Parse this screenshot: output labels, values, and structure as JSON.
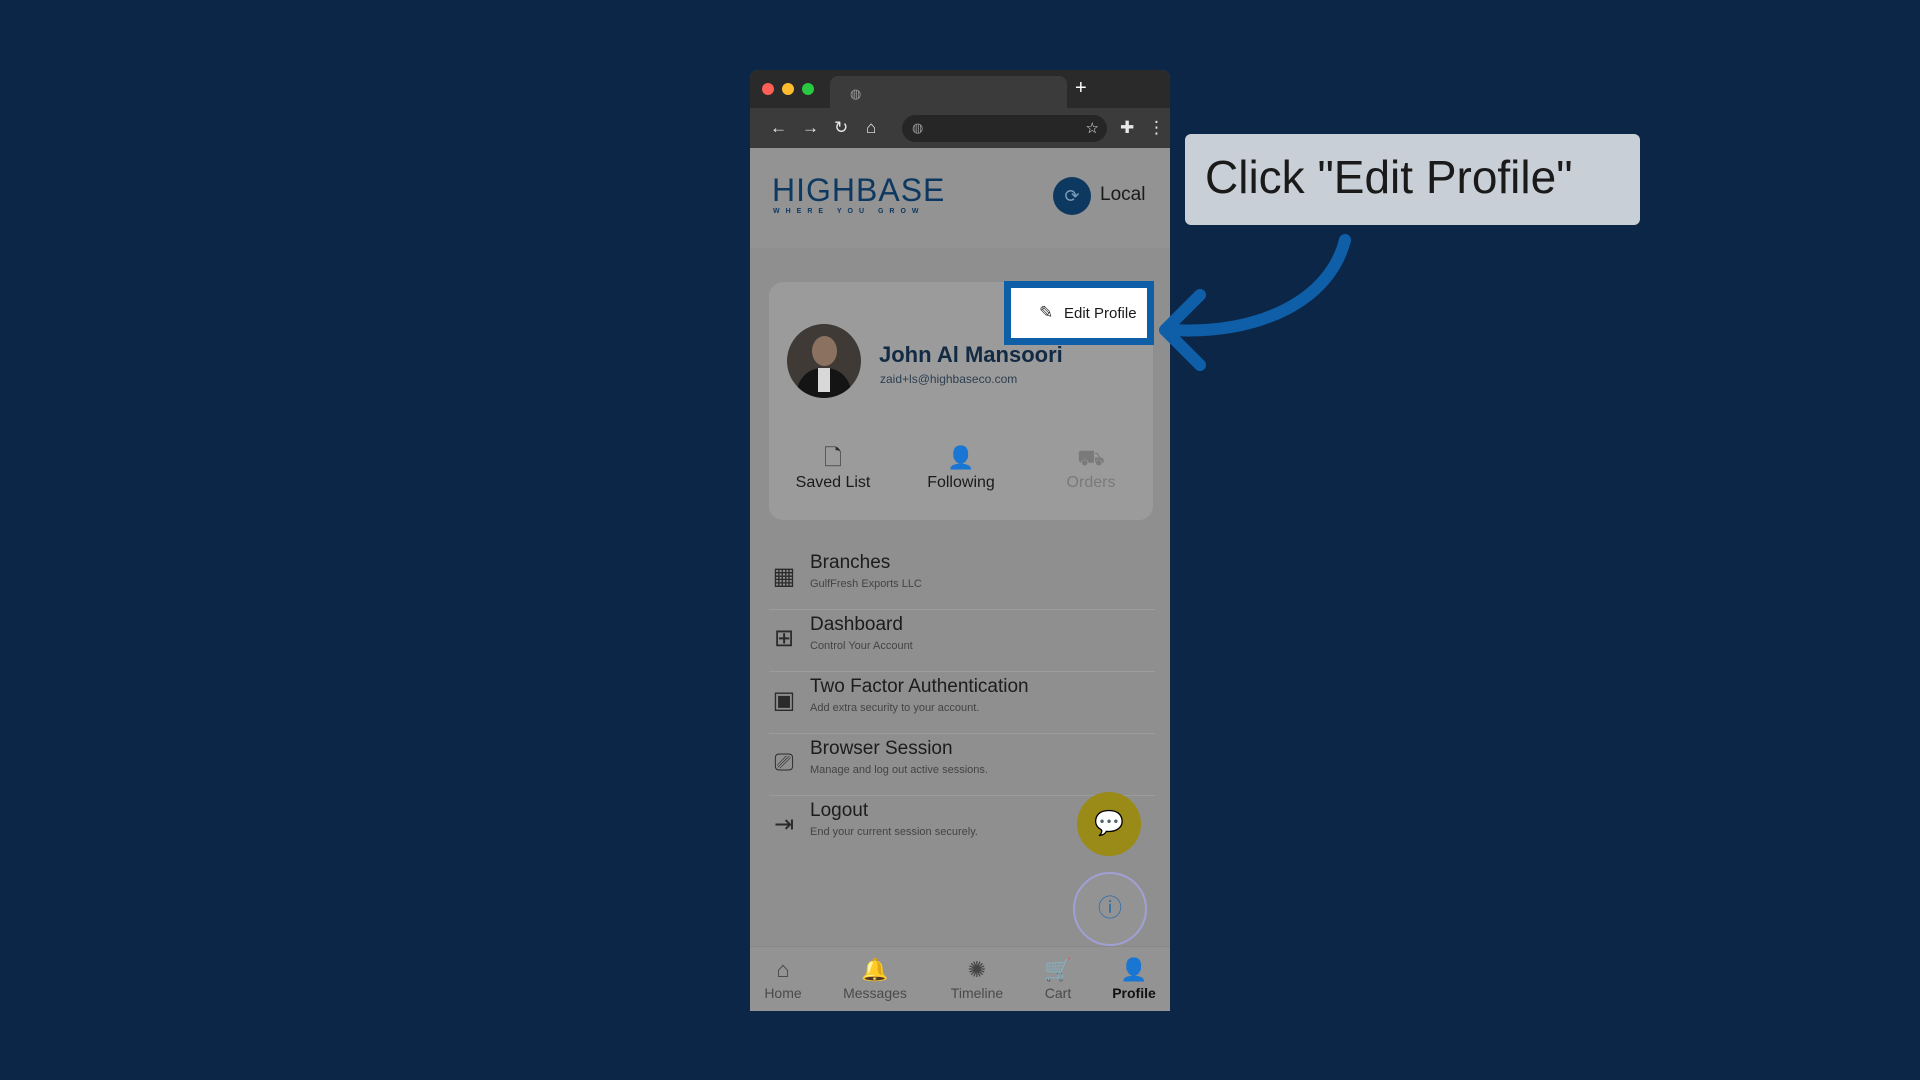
{
  "browser": {
    "controls": [
      "close",
      "minimize",
      "maximize"
    ],
    "tab_icon": "globe-icon",
    "new_tab_label": "+",
    "nav_icons": [
      "back-arrow-icon",
      "forward-arrow-icon",
      "reload-icon",
      "home-icon"
    ],
    "address_icon": "globe-icon",
    "right_icons": [
      "bookmark-star-icon",
      "extensions-icon",
      "menu-dots-icon"
    ]
  },
  "header": {
    "logo_text": "HIGHBASE",
    "logo_tagline": "WHERE YOU GROW",
    "language_label": "Local"
  },
  "profile": {
    "edit_button_label": "Edit Profile",
    "name": "John Al Mansoori",
    "email": "zaid+ls@highbaseco.com",
    "quick_actions": [
      {
        "label": "Saved List",
        "icon": "document-icon"
      },
      {
        "label": "Following",
        "icon": "user-plus-icon"
      },
      {
        "label": "Orders",
        "icon": "truck-icon"
      }
    ]
  },
  "menu": [
    {
      "title": "Branches",
      "subtitle": "GulfFresh Exports LLC",
      "icon": "building-icon"
    },
    {
      "title": "Dashboard",
      "subtitle": "Control Your Account",
      "icon": "grid-icon"
    },
    {
      "title": "Two Factor Authentication",
      "subtitle": "Add extra security to your account.",
      "icon": "shield-screen-icon"
    },
    {
      "title": "Browser Session",
      "subtitle": "Manage and log out active sessions.",
      "icon": "monitor-user-icon"
    },
    {
      "title": "Logout",
      "subtitle": "End your current session securely.",
      "icon": "logout-icon"
    }
  ],
  "bottom_nav": [
    {
      "label": "Home",
      "icon": "home-icon"
    },
    {
      "label": "Messages",
      "icon": "bell-icon"
    },
    {
      "label": "Timeline",
      "icon": "timeline-icon"
    },
    {
      "label": "Cart",
      "icon": "cart-icon"
    },
    {
      "label": "Profile",
      "icon": "user-icon",
      "active": true
    }
  ],
  "callout": {
    "text": "Click \"Edit Profile\""
  },
  "colors": {
    "background": "#0b2647",
    "highlight": "#0f5fa8",
    "brand": "#0d3960",
    "chat_fab": "#9a8a18"
  }
}
